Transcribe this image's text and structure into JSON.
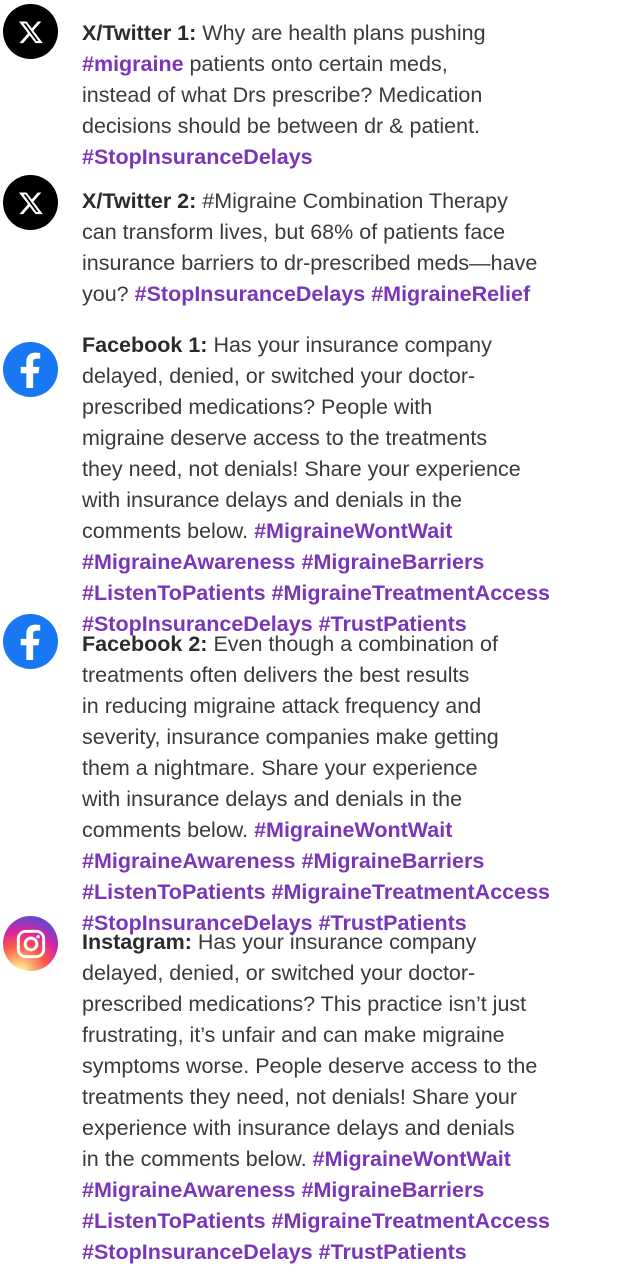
{
  "posts": [
    {
      "platform": "x",
      "icon": "x-logo-icon",
      "label": "X/Twitter 1:",
      "lines": [
        [
          {
            "t": "Why are health plans pushing",
            "k": "body"
          }
        ],
        [
          {
            "t": "#migraine",
            "k": "tag"
          },
          {
            "t": " patients onto certain meds,",
            "k": "body"
          }
        ],
        [
          {
            "t": "instead of what Drs prescribe? Medication",
            "k": "body"
          }
        ],
        [
          {
            "t": "decisions should be between dr & patient.",
            "k": "body"
          }
        ],
        [
          {
            "t": "#StopInsuranceDelays",
            "k": "tag"
          }
        ]
      ]
    },
    {
      "platform": "x",
      "icon": "x-logo-icon",
      "label": "X/Twitter 2:",
      "lines": [
        [
          {
            "t": "#Migraine Combination Therapy",
            "k": "body"
          }
        ],
        [
          {
            "t": "can transform lives, but 68% of patients face",
            "k": "body"
          }
        ],
        [
          {
            "t": "insurance barriers to dr-prescribed meds—have",
            "k": "body"
          }
        ],
        [
          {
            "t": "you? ",
            "k": "body"
          },
          {
            "t": "#StopInsuranceDelays #MigraineRelief",
            "k": "tag"
          }
        ]
      ]
    },
    {
      "platform": "facebook",
      "icon": "facebook-logo-icon",
      "label": "Facebook 1:",
      "lines": [
        [
          {
            "t": "Has your insurance company",
            "k": "body"
          }
        ],
        [
          {
            "t": "delayed, denied, or switched your doctor-",
            "k": "body"
          }
        ],
        [
          {
            "t": "prescribed medications? People with",
            "k": "body"
          }
        ],
        [
          {
            "t": "migraine deserve access to the treatments",
            "k": "body"
          }
        ],
        [
          {
            "t": "they need, not denials! Share your experience",
            "k": "body"
          }
        ],
        [
          {
            "t": "with insurance delays and denials in the",
            "k": "body"
          }
        ],
        [
          {
            "t": "comments below. ",
            "k": "body"
          },
          {
            "t": "#MigraineWontWait",
            "k": "tag"
          }
        ],
        [
          {
            "t": "#MigraineAwareness #MigraineBarriers",
            "k": "tag"
          }
        ],
        [
          {
            "t": "#ListenToPatients #MigraineTreatmentAccess",
            "k": "tag"
          }
        ],
        [
          {
            "t": "#StopInsuranceDelays #TrustPatients",
            "k": "tag"
          }
        ]
      ]
    },
    {
      "platform": "facebook",
      "icon": "facebook-logo-icon",
      "label": "Facebook 2:",
      "lines": [
        [
          {
            "t": "Even though a combination of",
            "k": "body"
          }
        ],
        [
          {
            "t": "treatments often delivers the best results",
            "k": "body"
          }
        ],
        [
          {
            "t": "in reducing migraine attack frequency and",
            "k": "body"
          }
        ],
        [
          {
            "t": "severity, insurance companies make getting",
            "k": "body"
          }
        ],
        [
          {
            "t": "them a nightmare. Share your experience",
            "k": "body"
          }
        ],
        [
          {
            "t": "with insurance delays and denials in the",
            "k": "body"
          }
        ],
        [
          {
            "t": "comments below. ",
            "k": "body"
          },
          {
            "t": "#MigraineWontWait",
            "k": "tag"
          }
        ],
        [
          {
            "t": "#MigraineAwareness #MigraineBarriers",
            "k": "tag"
          }
        ],
        [
          {
            "t": "#ListenToPatients #MigraineTreatmentAccess",
            "k": "tag"
          }
        ],
        [
          {
            "t": "#StopInsuranceDelays #TrustPatients",
            "k": "tag"
          }
        ]
      ]
    },
    {
      "platform": "instagram",
      "icon": "instagram-logo-icon",
      "label": "Instagram:",
      "lines": [
        [
          {
            "t": "Has your insurance company",
            "k": "body"
          }
        ],
        [
          {
            "t": "delayed, denied, or switched your doctor-",
            "k": "body"
          }
        ],
        [
          {
            "t": "prescribed medications? This practice isn’t just",
            "k": "body"
          }
        ],
        [
          {
            "t": "frustrating, it’s unfair and can make migraine",
            "k": "body"
          }
        ],
        [
          {
            "t": "symptoms worse. People deserve access to the",
            "k": "body"
          }
        ],
        [
          {
            "t": "treatments they need, not denials! Share your",
            "k": "body"
          }
        ],
        [
          {
            "t": "experience with insurance delays and denials",
            "k": "body"
          }
        ],
        [
          {
            "t": "in the comments below. ",
            "k": "body"
          },
          {
            "t": "#MigraineWontWait",
            "k": "tag"
          }
        ],
        [
          {
            "t": "#MigraineAwareness #MigraineBarriers",
            "k": "tag"
          }
        ],
        [
          {
            "t": "#ListenToPatients #MigraineTreatmentAccess",
            "k": "tag"
          }
        ],
        [
          {
            "t": "#StopInsuranceDelays #TrustPatients",
            "k": "tag"
          }
        ]
      ]
    }
  ]
}
